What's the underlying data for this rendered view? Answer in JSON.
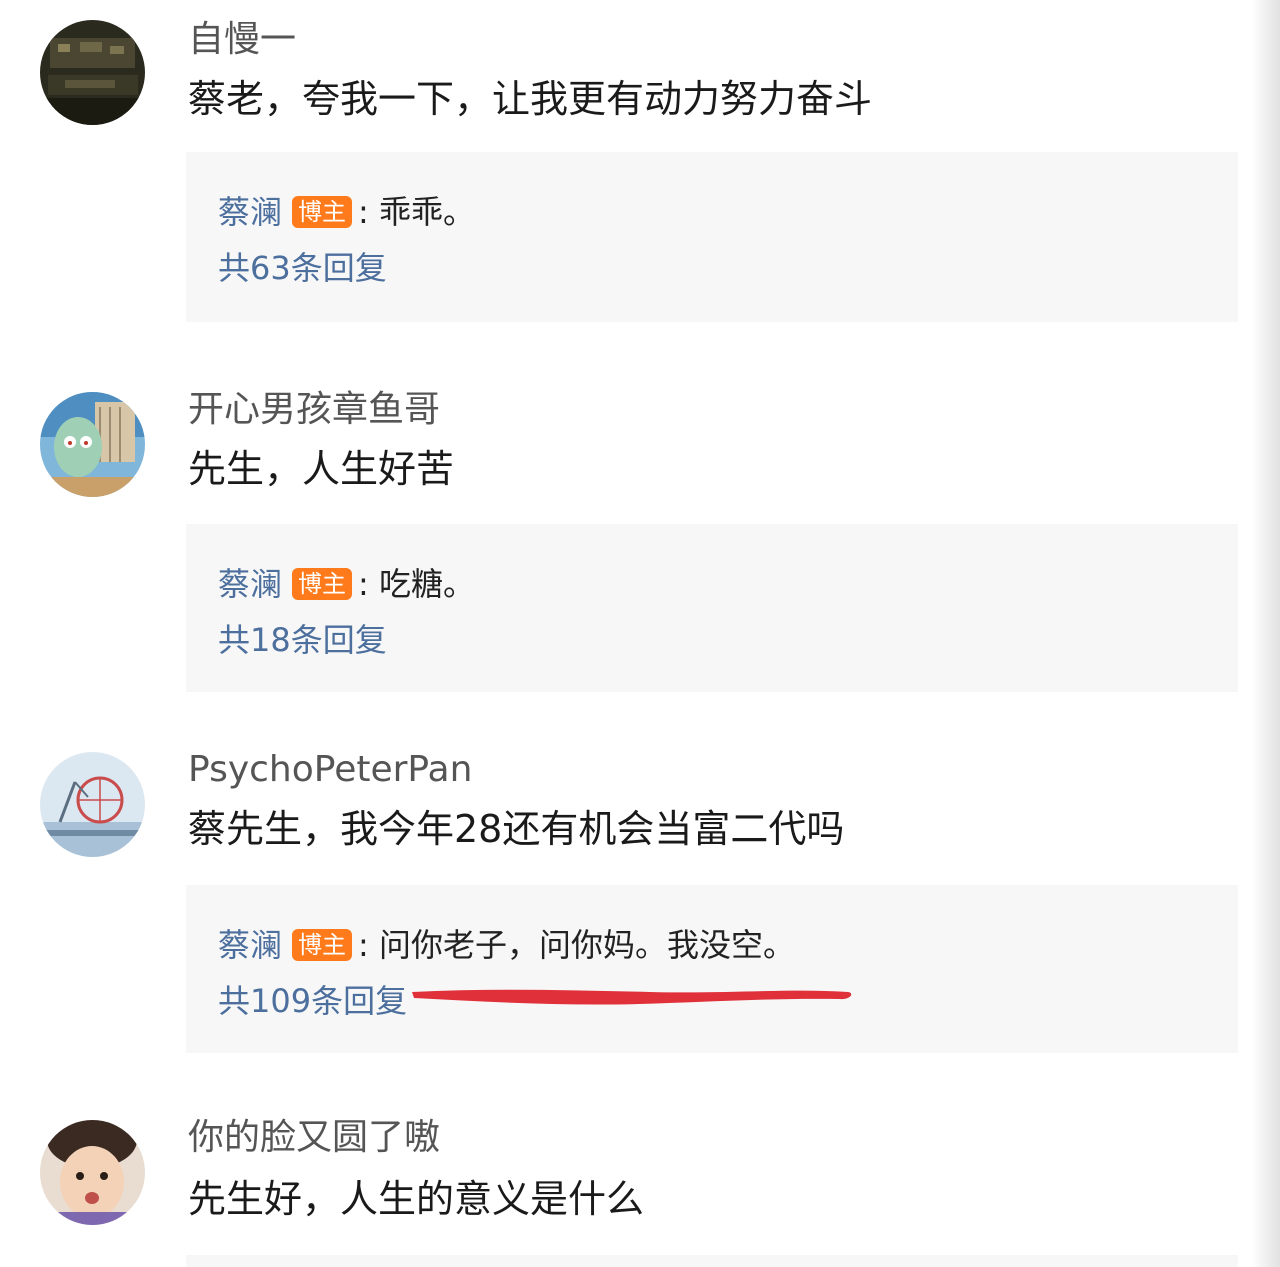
{
  "comments": [
    {
      "username": "自慢一",
      "content": "蔡老，夸我一下，让我更有动力努力奋斗",
      "reply": {
        "author": "蔡澜",
        "badge": "博主",
        "separator": ":",
        "text": "乖乖。",
        "count": "共63条回复"
      }
    },
    {
      "username": "开心男孩章鱼哥",
      "content": "先生，人生好苦",
      "reply": {
        "author": "蔡澜",
        "badge": "博主",
        "separator": ":",
        "text": "吃糖。",
        "count": "共18条回复"
      }
    },
    {
      "username": "PsychoPeterPan",
      "content": "蔡先生，我今年28还有机会当富二代吗",
      "reply": {
        "author": "蔡澜",
        "badge": "博主",
        "separator": ":",
        "text": "问你老子，问你妈。我没空。",
        "count": "共109条回复"
      }
    },
    {
      "username": "你的脸又圆了嗷",
      "content": "先生好，人生的意义是什么"
    }
  ],
  "colors": {
    "author_link": "#4c6f9e",
    "badge_bg": "#ff7a1a",
    "reply_bg": "#f7f7f7",
    "annotation_red": "#e0303a"
  }
}
